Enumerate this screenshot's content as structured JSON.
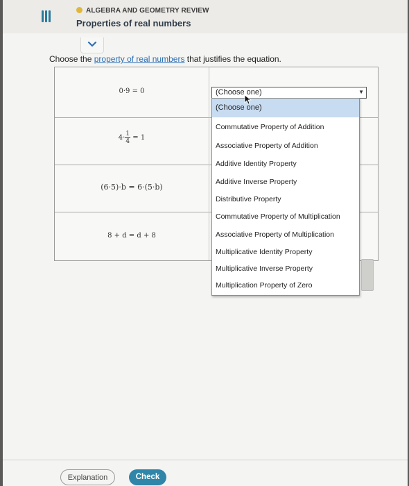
{
  "header": {
    "section": "ALGEBRA AND GEOMETRY REVIEW",
    "title": "Properties of real numbers"
  },
  "prompt": {
    "before": "Choose the ",
    "link": "property of real numbers",
    "after": " that justifies the equation."
  },
  "equations": {
    "row1": "0·9 = 0",
    "row2_left": "4·",
    "row2_num": "1",
    "row2_den": "4",
    "row2_right": "= 1",
    "row3": "(6·5)·b = 6·(5·b)",
    "row4": "8 + d = d + 8"
  },
  "select": {
    "value": "(Choose one)"
  },
  "dropdown": {
    "options": [
      "(Choose one)",
      "Commutative Property of Addition",
      "Associative Property of Addition",
      "Additive Identity Property",
      "Additive Inverse Property",
      "Distributive Property",
      "Commutative Property of Multiplication",
      "Associative Property of Multiplication",
      "Multiplicative Identity Property",
      "Multiplicative Inverse Property",
      "Multiplication Property of Zero"
    ],
    "selected_index": 0
  },
  "footer": {
    "explanation_label": "Explanation",
    "check_label": "Check"
  },
  "colors": {
    "accent": "#2f86a9",
    "highlight": "#c7dbf1",
    "status_dot": "#e0b73d"
  }
}
